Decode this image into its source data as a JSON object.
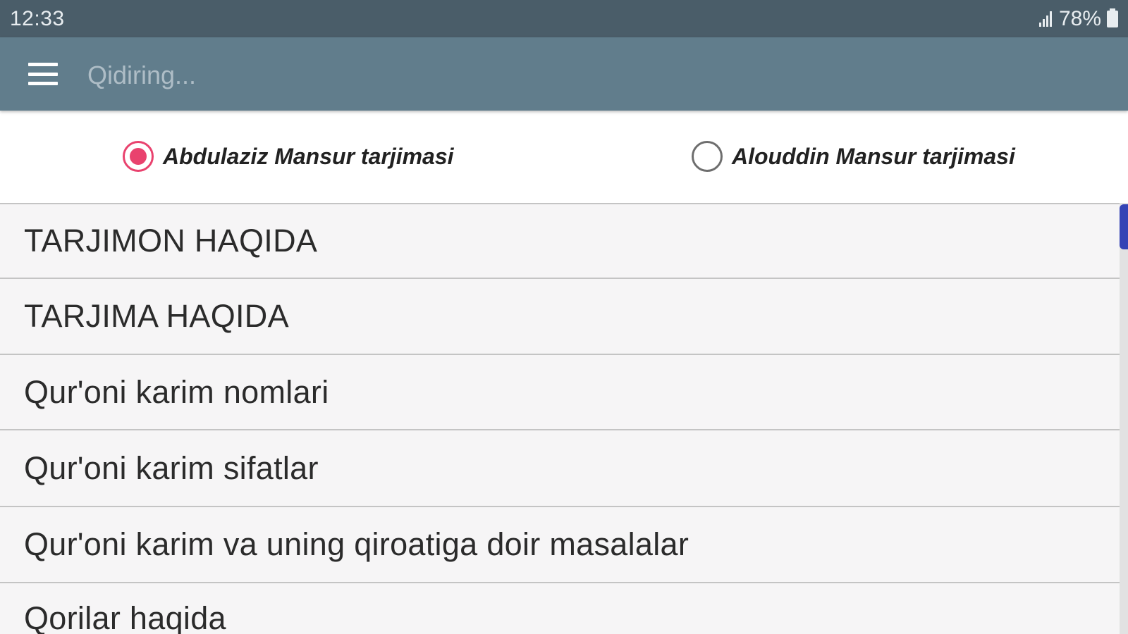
{
  "status_bar": {
    "time": "12:33",
    "battery": "78%",
    "signal_icon": "signal-icon",
    "battery_icon": "battery-icon"
  },
  "toolbar": {
    "menu_icon": "menu-icon",
    "search_placeholder": "Qidiring..."
  },
  "translation_options": [
    {
      "label": "Abdulaziz Mansur tarjimasi",
      "selected": true
    },
    {
      "label": "Alouddin Mansur tarjimasi",
      "selected": false
    }
  ],
  "list_items": [
    {
      "label": "TARJIMON HAQIDA"
    },
    {
      "label": "TARJIMA HAQIDA"
    },
    {
      "label": "Qur'oni karim nomlari"
    },
    {
      "label": "Qur'oni karim sifatlar"
    },
    {
      "label": "Qur'oni karim va uning qiroatiga doir masalalar"
    },
    {
      "label": "Qorilar haqida"
    }
  ],
  "colors": {
    "status_bar": "#4a5d69",
    "toolbar": "#617d8c",
    "radio_accent": "#e9426e",
    "scroll_thumb": "#3543b5"
  }
}
